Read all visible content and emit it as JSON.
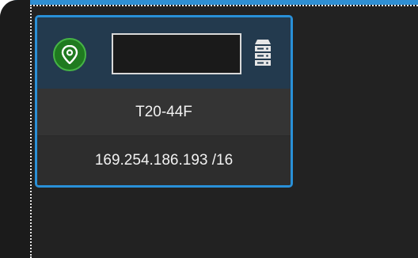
{
  "device_card": {
    "name_input": {
      "value": "",
      "placeholder": ""
    },
    "model": "T20-44F",
    "ip_address": "169.254.186.193 /16",
    "icons": {
      "location": "map-pin-icon",
      "device": "server-icon"
    },
    "colors": {
      "accent_border": "#2990d8",
      "status_green": "#46b446",
      "header_bg": "#233a4e"
    }
  }
}
